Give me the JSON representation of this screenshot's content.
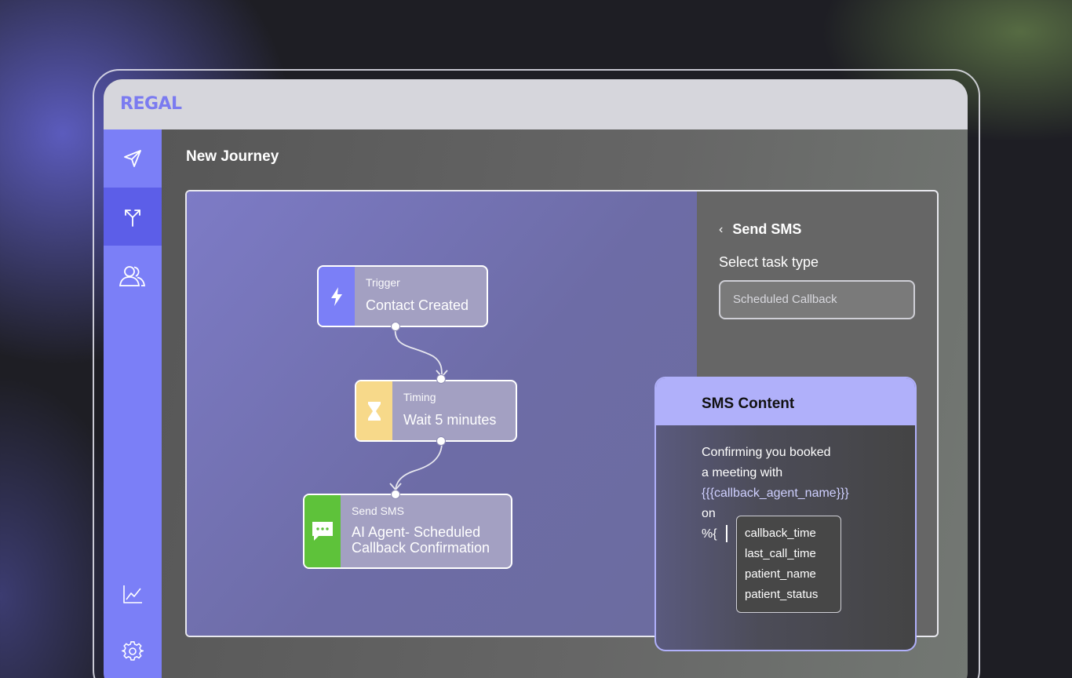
{
  "app": {
    "logo_text": "REGAL",
    "accent": "#7b7ff7",
    "active_nav": "#5c5ee8"
  },
  "sidebar": {
    "items": [
      {
        "name": "send",
        "icon": "paper-plane-icon"
      },
      {
        "name": "journeys",
        "icon": "split-arrows-icon",
        "active": true
      },
      {
        "name": "contacts",
        "icon": "users-icon"
      },
      {
        "name": "analytics",
        "icon": "line-chart-icon"
      },
      {
        "name": "settings",
        "icon": "gear-icon"
      }
    ]
  },
  "page": {
    "title": "New Journey"
  },
  "flow": {
    "nodes": [
      {
        "kind": "Trigger",
        "label": "Contact Created",
        "icon": "lightning-icon",
        "color": "#7b7ff7"
      },
      {
        "kind": "Timing",
        "label": "Wait 5 minutes",
        "icon": "hourglass-icon",
        "color": "#f7d98a"
      },
      {
        "kind": "Send SMS",
        "label_line1": "AI Agent- Scheduled",
        "label_line2": "Callback Confirmation",
        "icon": "chat-bubble-icon",
        "color": "#5ec23a"
      }
    ]
  },
  "panel": {
    "back_label": "Send SMS",
    "select_label": "Select task type",
    "task_type_value": "Scheduled Callback"
  },
  "sms": {
    "title": "SMS Content",
    "line1": "Confirming you booked",
    "line2": "a meeting with",
    "variable": "{{{callback_agent_name}}}",
    "line4": "on",
    "typed": "%{",
    "suggestions": [
      "callback_time",
      "last_call_time",
      "patient_name",
      "patient_status"
    ]
  }
}
